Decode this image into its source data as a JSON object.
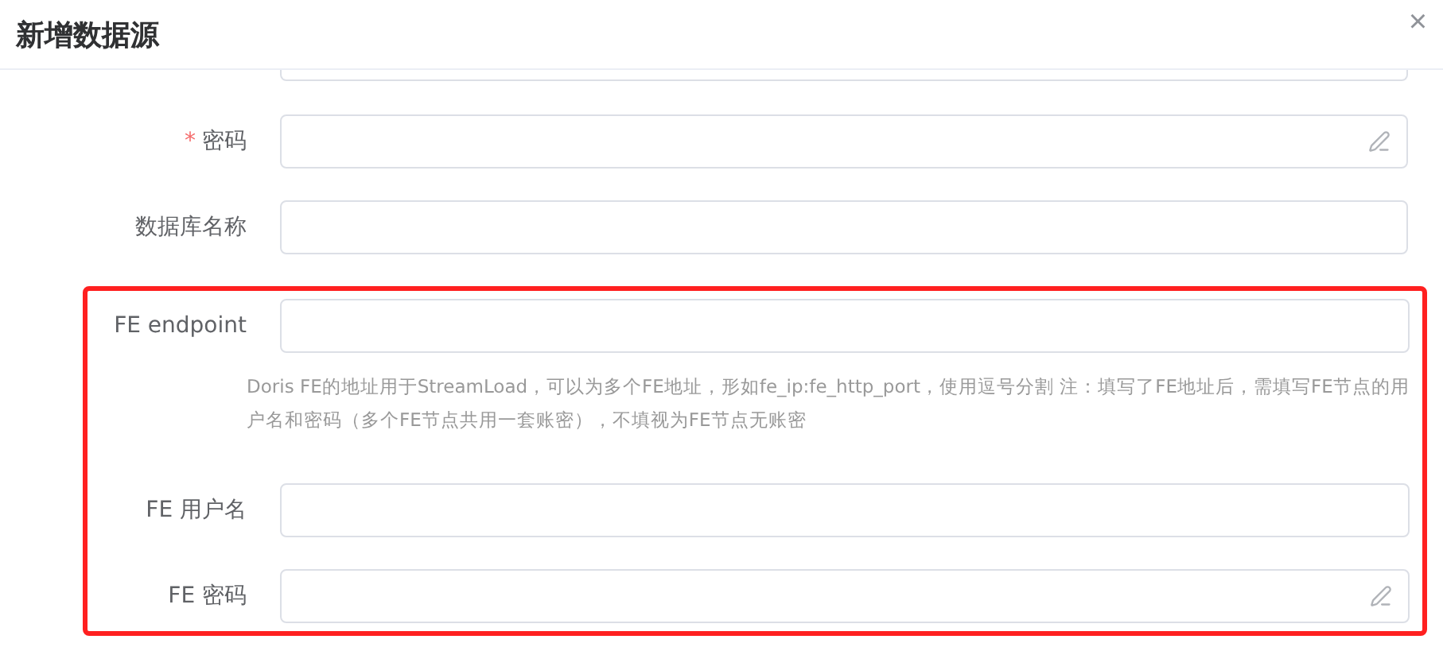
{
  "dialog": {
    "title": "新增数据源",
    "close": "×"
  },
  "fields": [
    {
      "kind": "clipped"
    },
    {
      "kind": "password",
      "label": "密码",
      "required": true
    },
    {
      "kind": "text",
      "label": "数据库名称",
      "required": false
    },
    {
      "kind": "text",
      "label": "FE endpoint",
      "required": false,
      "highlighted": true,
      "help": "Doris FE的地址用于StreamLoad，可以为多个FE地址，形如fe_ip:fe_http_port，使用逗号分割 注：填写了FE地址后，需填写FE节点的用户名和密码（多个FE节点共用一套账密），不填视为FE节点无账密"
    },
    {
      "kind": "text",
      "label": "FE 用户名",
      "required": false,
      "highlighted": true
    },
    {
      "kind": "password",
      "label": "FE 密码",
      "required": false,
      "highlighted": true
    }
  ],
  "required_mark": "*"
}
